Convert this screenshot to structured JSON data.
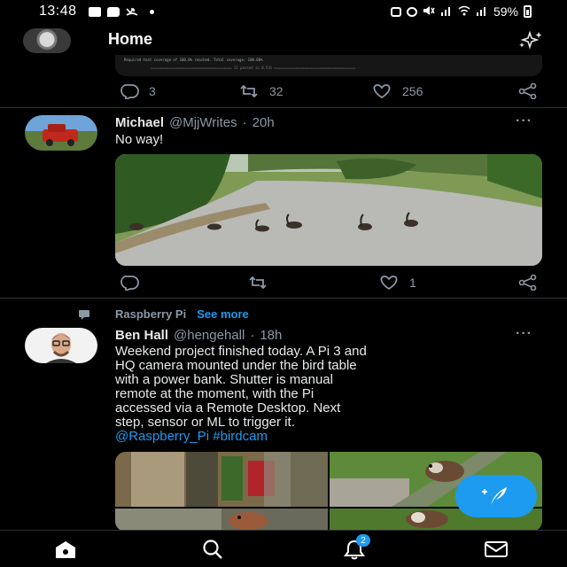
{
  "status_bar": {
    "time": "13:48",
    "battery": "59%",
    "icons": [
      "image-icon",
      "message-icon",
      "missed-call-icon",
      "dot-icon",
      "home-icon",
      "alarm-icon",
      "mute-icon",
      "signal-icon",
      "wifi-icon",
      "signal-icon",
      "battery-icon"
    ]
  },
  "header": {
    "title": "Home",
    "sparkle_icon": "sparkle-icon"
  },
  "tweets": [
    {
      "code_lines": [
        "Required test coverage of 100.0% reached. Total coverage: 100.00%",
        "====================================== 11 passed in 0.53s ======================================"
      ],
      "actions": {
        "replies": "3",
        "retweets": "32",
        "likes": "256"
      }
    },
    {
      "name": "Michael",
      "handle": "@MjjWrites",
      "time": "20h",
      "separator": "·",
      "text": "No way!",
      "actions": {
        "replies": "",
        "retweets": "",
        "likes": "1"
      }
    },
    {
      "context": {
        "label": "Raspberry Pi",
        "see_more": "See more"
      },
      "name": "Ben Hall",
      "handle": "@hengehall",
      "time": "18h",
      "separator": "·",
      "text_lines": [
        "Weekend project finished today. A Pi 3 and",
        "HQ camera mounted under the bird table",
        "with a power bank. Shutter is manual",
        "remote at the moment, with the Pi",
        "accessed via a Remote Desktop. Next",
        "step, sensor or ML to trigger it."
      ],
      "links": [
        "@Raspberry_Pi",
        "#birdcam"
      ]
    }
  ],
  "more_label": "···",
  "nav": {
    "notifications_badge": "2",
    "icons": [
      "home-icon",
      "search-icon",
      "bell-icon",
      "mail-icon"
    ]
  },
  "colors": {
    "accent": "#1d9bf0",
    "background": "#000000",
    "secondary_text": "#8b98a5"
  }
}
